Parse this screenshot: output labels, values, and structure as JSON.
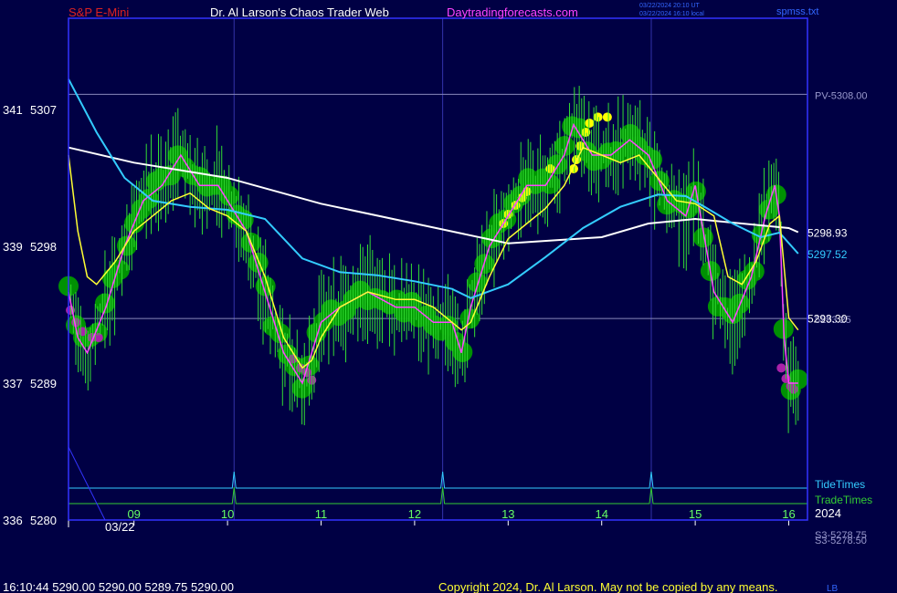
{
  "header": {
    "instrument": "S&P E-Mini",
    "site_title": "Dr. Al Larson's Chaos Trader Web",
    "site_url": "Daytradingforecasts.com",
    "timestamp_ut": "03/22/2024 20:10 UT",
    "timestamp_local": "03/22/2024 16:10 local",
    "filename": "spmss.txt"
  },
  "footer": {
    "status": "16:10:44  5290.00 5290.00 5289.75 5290.00",
    "copyright": "Copyright 2024, Dr. Al Larson. May not be copied by any means.",
    "corner": "LB"
  },
  "colors": {
    "background": "#000044",
    "frame": "#3333ff",
    "price_bars": "#33dd33",
    "green_dots": "#009900",
    "magenta_dots": "#aa22aa",
    "yellow_dots": "#ffff00",
    "white_ma": "#ffffff",
    "cyan_ma": "#33ccff",
    "yellow_line": "#ffff33",
    "magenta_line": "#ff44ff",
    "tide_line": "#33ccff",
    "trade_line": "#33cc33",
    "title_red": "#dd2222",
    "title_magenta": "#ff44ff"
  },
  "chart_data": {
    "type": "line",
    "title": "S&P E-Mini",
    "date_label": "03/22",
    "year_label": "2024",
    "x_ticks": [
      "09",
      "10",
      "11",
      "12",
      "13",
      "14",
      "15",
      "16"
    ],
    "x_range": [
      8.3,
      16.2
    ],
    "y_range": [
      5280,
      5313
    ],
    "y_ticks": [
      {
        "left": "341",
        "price": "5307",
        "value": 5307
      },
      {
        "left": "339",
        "price": "5298",
        "value": 5298
      },
      {
        "left": "337",
        "price": "5289",
        "value": 5289
      },
      {
        "left": "336",
        "price": "5280",
        "value": 5280
      }
    ],
    "horizontal_levels": [
      {
        "label": "PV-5308.00",
        "value": 5308.0
      },
      {
        "label": "5293.25",
        "value": 5293.25
      },
      {
        "label": "S3-5278.75",
        "value": 5278.75
      },
      {
        "label": "S3-5278.50",
        "value": 5278.5
      }
    ],
    "right_values": [
      {
        "label": "5298.93",
        "value": 5298.93,
        "series": "white"
      },
      {
        "label": "5297.52",
        "value": 5297.52,
        "series": "cyan"
      },
      {
        "label": "5293.30",
        "value": 5293.3,
        "series": "yellow"
      }
    ],
    "vertical_lines": [
      10.07,
      12.3,
      14.53
    ],
    "tide_times": {
      "label": "TideTimes",
      "spikes": [
        10.07,
        12.3,
        14.53
      ]
    },
    "trade_times": {
      "label": "TradeTimes",
      "spikes": [
        10.07,
        12.3,
        14.53
      ]
    },
    "series": [
      {
        "key": "price",
        "x": [
          8.3,
          8.4,
          8.5,
          8.7,
          8.9,
          9.1,
          9.3,
          9.5,
          9.7,
          9.9,
          10.0,
          10.2,
          10.4,
          10.6,
          10.8,
          10.9,
          11.0,
          11.2,
          11.5,
          11.8,
          12.0,
          12.2,
          12.4,
          12.5,
          12.6,
          12.8,
          13.0,
          13.2,
          13.4,
          13.6,
          13.7,
          13.9,
          14.1,
          14.3,
          14.5,
          14.7,
          14.9,
          15.0,
          15.2,
          15.4,
          15.6,
          15.75,
          15.85,
          15.9,
          15.95,
          16.0,
          16.1
        ],
        "y": [
          5295,
          5292,
          5291,
          5294,
          5298,
          5301,
          5302,
          5304,
          5302,
          5302,
          5301,
          5299,
          5295,
          5291,
          5289,
          5291,
          5293,
          5294,
          5295,
          5294,
          5294,
          5293,
          5293,
          5291,
          5294,
          5298,
          5300,
          5302,
          5302,
          5304,
          5306,
          5304,
          5304,
          5305,
          5304,
          5301,
          5300,
          5302,
          5295,
          5293,
          5296,
          5300,
          5302,
          5300,
          5292,
          5289,
          5289
        ]
      },
      {
        "key": "white",
        "x": [
          8.3,
          9.0,
          10.0,
          11.0,
          12.0,
          13.0,
          14.0,
          14.5,
          15.0,
          15.5,
          16.0,
          16.1
        ],
        "y": [
          5304.5,
          5303.5,
          5302.5,
          5300.8,
          5299.5,
          5298.2,
          5298.6,
          5299.5,
          5299.8,
          5299.5,
          5299.2,
          5298.93
        ]
      },
      {
        "key": "cyan",
        "x": [
          8.3,
          8.6,
          8.9,
          9.2,
          9.6,
          10.0,
          10.4,
          10.8,
          11.2,
          11.6,
          12.0,
          12.4,
          12.6,
          13.0,
          13.4,
          13.8,
          14.2,
          14.6,
          14.9,
          15.1,
          15.4,
          15.7,
          15.9,
          16.1
        ],
        "y": [
          5309,
          5305.5,
          5302.5,
          5301,
          5300.6,
          5300.4,
          5299.8,
          5297.2,
          5296.3,
          5296.1,
          5295.7,
          5295.2,
          5294.6,
          5295.5,
          5297.3,
          5299.2,
          5300.6,
          5301.4,
          5301.3,
          5300.6,
          5299.5,
          5298.6,
          5298.9,
          5297.52
        ]
      },
      {
        "key": "yellow",
        "x": [
          8.3,
          8.4,
          8.5,
          8.6,
          8.8,
          9.0,
          9.2,
          9.4,
          9.6,
          9.8,
          10.0,
          10.2,
          10.4,
          10.6,
          10.8,
          10.9,
          11.0,
          11.2,
          11.5,
          11.8,
          12.0,
          12.2,
          12.4,
          12.5,
          12.6,
          12.8,
          13.0,
          13.2,
          13.4,
          13.6,
          13.8,
          14.0,
          14.2,
          14.4,
          14.6,
          14.8,
          15.0,
          15.2,
          15.35,
          15.5,
          15.65,
          15.8,
          15.9,
          16.0,
          16.1
        ],
        "y": [
          5304,
          5299,
          5296,
          5295.5,
          5297,
          5299,
          5300,
          5301,
          5301.5,
          5300.5,
          5300,
          5299,
          5296,
          5292,
          5290,
          5290.5,
          5292,
          5294,
          5295,
          5294.5,
          5294.5,
          5294,
          5293,
          5292.5,
          5293,
          5296,
          5298.5,
          5299.5,
          5300.5,
          5302,
          5304.5,
          5304,
          5303.5,
          5304,
          5302.5,
          5301,
          5300.8,
          5300,
          5296,
          5295.5,
          5297,
          5299.5,
          5300,
          5293.3,
          5292.5
        ]
      }
    ],
    "yellow_dots": [
      {
        "x": 12.95,
        "y": 5299.5
      },
      {
        "x": 13.0,
        "y": 5300.1
      },
      {
        "x": 13.08,
        "y": 5300.7
      },
      {
        "x": 13.15,
        "y": 5301.2
      },
      {
        "x": 13.2,
        "y": 5301.6
      },
      {
        "x": 13.45,
        "y": 5303.1
      },
      {
        "x": 13.7,
        "y": 5303.1
      },
      {
        "x": 13.73,
        "y": 5303.7
      },
      {
        "x": 13.77,
        "y": 5304.6
      },
      {
        "x": 13.83,
        "y": 5305.5
      },
      {
        "x": 13.87,
        "y": 5306.1
      },
      {
        "x": 13.96,
        "y": 5306.5
      },
      {
        "x": 14.06,
        "y": 5306.5
      }
    ]
  }
}
